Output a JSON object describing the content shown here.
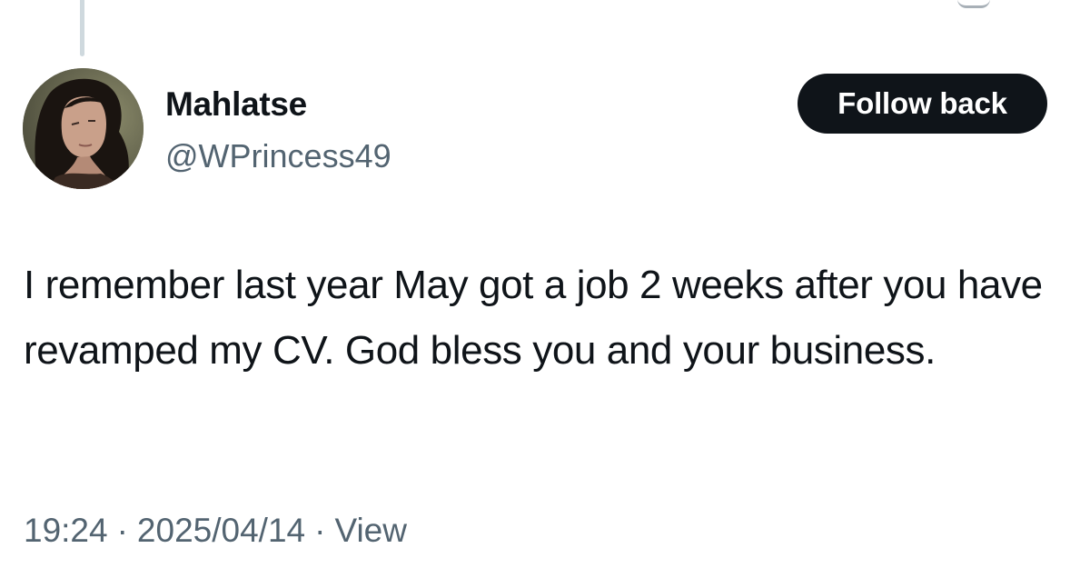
{
  "tweet": {
    "author": {
      "display_name": "Mahlatse",
      "handle": "@WPrincess49",
      "avatar_icon": "user-avatar-photo"
    },
    "follow_button_label": "Follow back",
    "text": "I remember last year May got a job 2 weeks after you have revamped my CV. God bless you and your business.",
    "meta": {
      "time": "19:24",
      "date": "2025/04/14",
      "separator": "·",
      "views_label": "View"
    }
  },
  "colors": {
    "text_primary": "#0f1419",
    "text_secondary": "#536471",
    "button_bg": "#0f1419",
    "button_text": "#ffffff",
    "thread_line": "#cfd9de"
  }
}
